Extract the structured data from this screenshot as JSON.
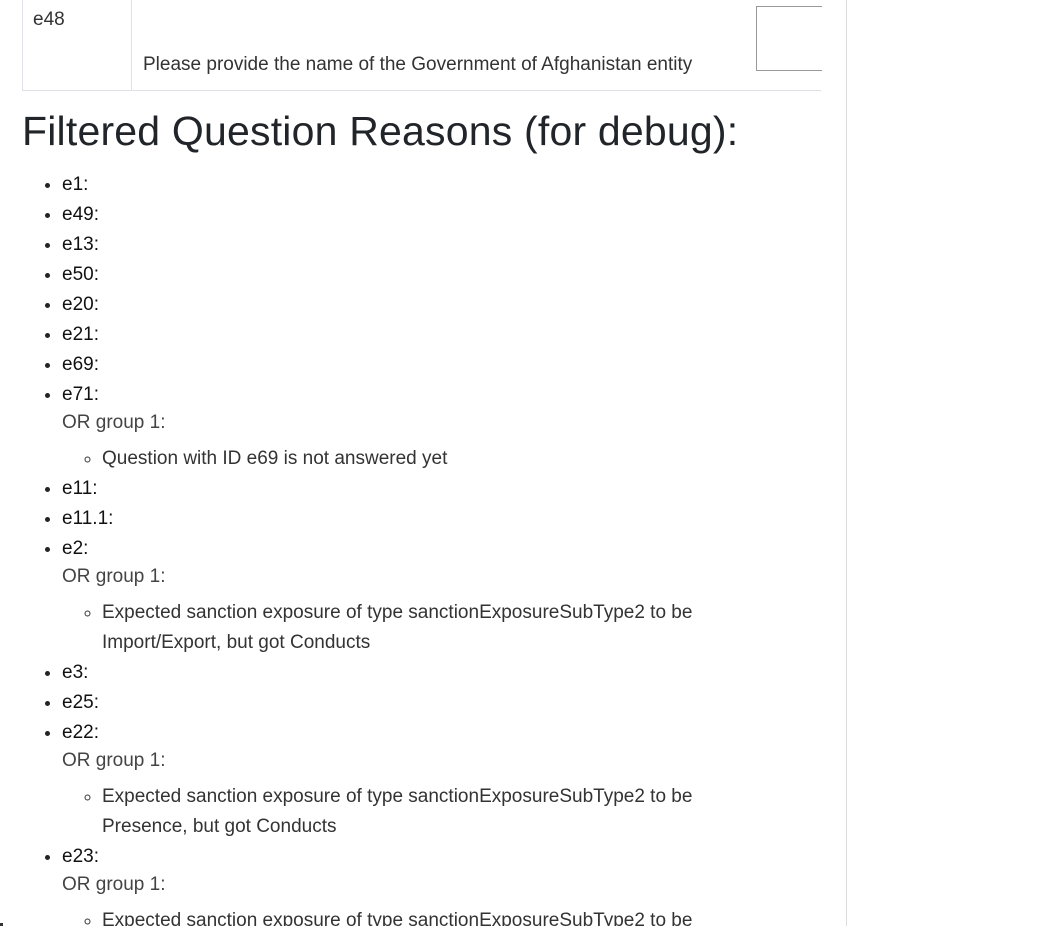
{
  "question_row": {
    "id": "e48",
    "text": "Please provide the name of the Government of Afghanistan entity",
    "input_value": ""
  },
  "debug_section": {
    "title": "Filtered Question Reasons (for debug):",
    "items": [
      {
        "label": "e1:",
        "groups": []
      },
      {
        "label": "e49:",
        "groups": []
      },
      {
        "label": "e13:",
        "groups": []
      },
      {
        "label": "e50:",
        "groups": []
      },
      {
        "label": "e20:",
        "groups": []
      },
      {
        "label": "e21:",
        "groups": []
      },
      {
        "label": "e69:",
        "groups": []
      },
      {
        "label": "e71:",
        "groups": [
          {
            "title": "OR group 1:",
            "conditions": [
              "Question with ID e69 is not answered yet"
            ]
          }
        ]
      },
      {
        "label": "e11:",
        "groups": []
      },
      {
        "label": "e11.1:",
        "groups": []
      },
      {
        "label": "e2:",
        "groups": [
          {
            "title": "OR group 1:",
            "conditions": [
              "Expected sanction exposure of type sanctionExposureSubType2 to be Import/Export, but got Conducts"
            ]
          }
        ]
      },
      {
        "label": "e3:",
        "groups": []
      },
      {
        "label": "e25:",
        "groups": []
      },
      {
        "label": "e22:",
        "groups": [
          {
            "title": "OR group 1:",
            "conditions": [
              "Expected sanction exposure of type sanctionExposureSubType2 to be Presence, but got Conducts"
            ]
          }
        ]
      },
      {
        "label": "e23:",
        "groups": [
          {
            "title": "OR group 1:",
            "conditions": [
              "Expected sanction exposure of type sanctionExposureSubType2 to be"
            ]
          }
        ]
      }
    ]
  }
}
